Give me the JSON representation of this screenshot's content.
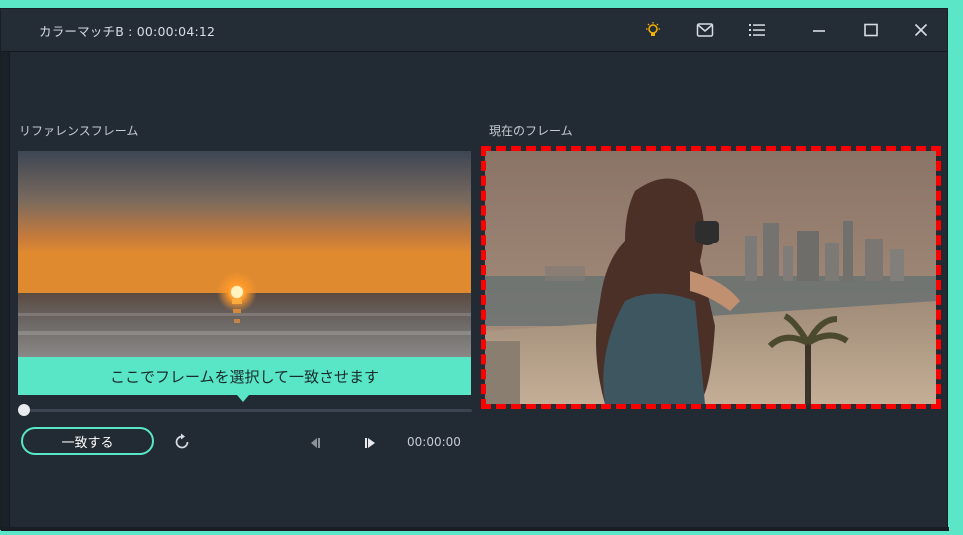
{
  "window": {
    "title": "カラーマッチB : 00:00:04:12"
  },
  "titlebar_icons": [
    "lightbulb-icon",
    "mail-icon",
    "menu-list-icon",
    "minimize-icon",
    "maximize-icon",
    "close-icon"
  ],
  "colors": {
    "accent": "#58e6c7",
    "highlight_dash": "#ff0000",
    "background": "#222a33",
    "lightbulb": "#f5b400"
  },
  "reference": {
    "label": "リファレンスフレーム"
  },
  "current": {
    "label": "現在のフレーム"
  },
  "tooltip": {
    "text": "ここでフレームを選択して一致させます"
  },
  "controls": {
    "match_button": "一致する",
    "timecode": "00:00:00",
    "slider_value": 0,
    "icons": [
      "reset-icon",
      "prev-frame-icon",
      "next-frame-icon"
    ]
  }
}
